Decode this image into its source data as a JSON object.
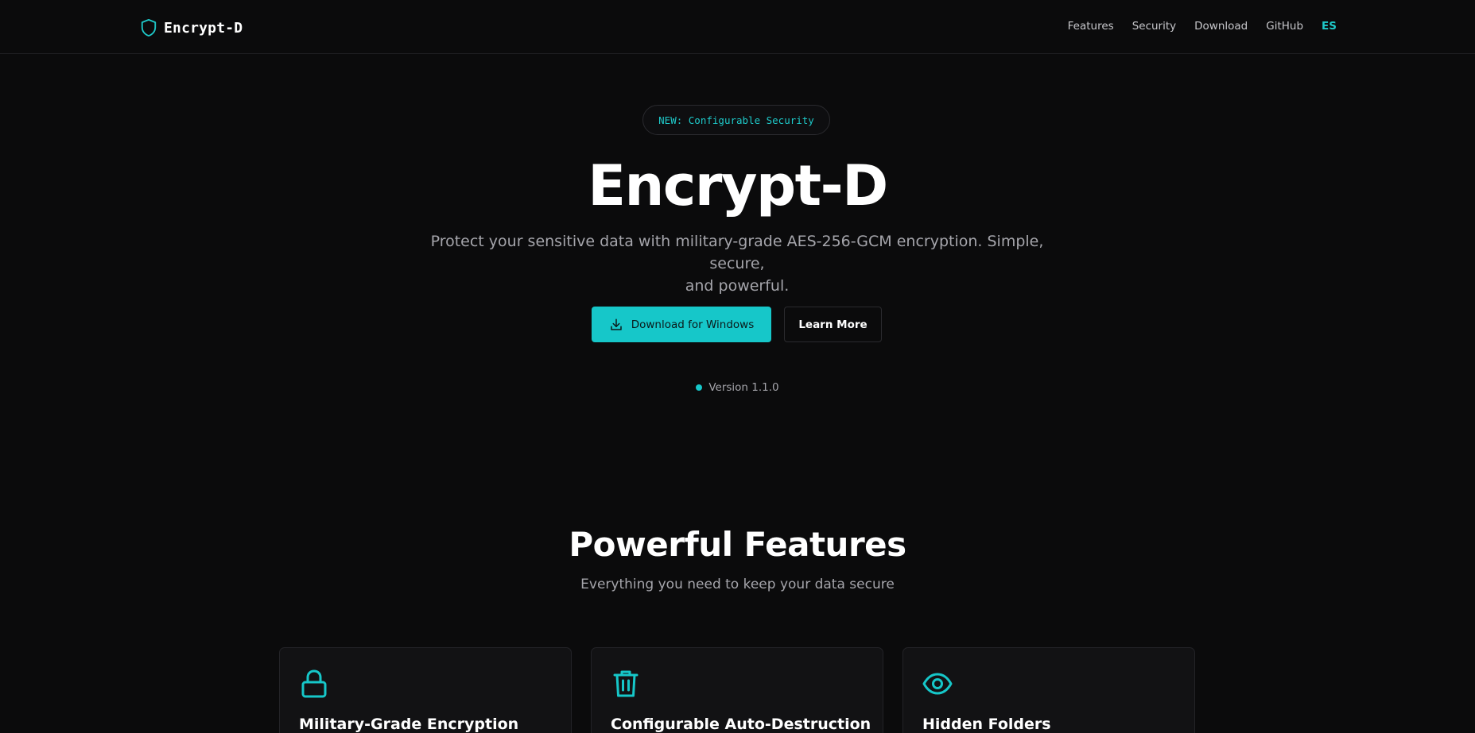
{
  "header": {
    "brand": "Encrypt-D",
    "nav": [
      "Features",
      "Security",
      "Download",
      "GitHub"
    ],
    "language": "ES"
  },
  "hero": {
    "badge": "NEW: Configurable Security",
    "title": "Encrypt-D",
    "subtitle_line1": "Protect your sensitive data with military-grade AES-256-GCM encryption. Simple, secure,",
    "subtitle_line2": "and powerful.",
    "primary_button": "Download for Windows",
    "secondary_button": "Learn More",
    "version": "Version 1.1.0"
  },
  "features": {
    "title": "Powerful Features",
    "subtitle": "Everything you need to keep your data secure",
    "cards": [
      {
        "title": "Military-Grade Encryption",
        "icon": "lock-icon"
      },
      {
        "title": "Configurable Auto-Destruction",
        "icon": "trash-icon"
      },
      {
        "title": "Hidden Folders",
        "icon": "eye-icon"
      }
    ]
  },
  "colors": {
    "accent": "#16c7c9",
    "background": "#0b0b0c",
    "card": "#121214",
    "muted_text": "#a5a5ab"
  }
}
